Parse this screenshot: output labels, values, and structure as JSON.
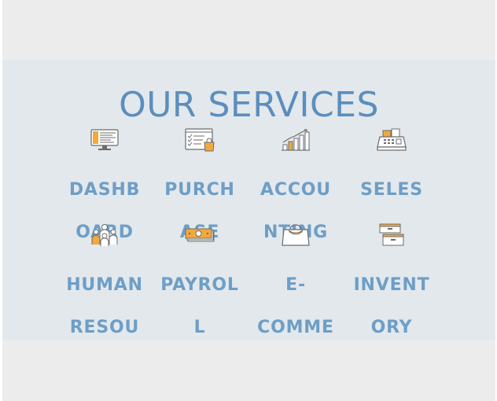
{
  "title": "OUR SERVICES",
  "colors": {
    "frame_bg": "#ececec",
    "band_bg": "#e3e8ec",
    "title": "#5b8ebf",
    "label": "#6d9ec7",
    "icon_stroke": "#6b6b6b",
    "icon_accent": "#f2a93b"
  },
  "services": [
    {
      "id": "dashboard",
      "icon": "monitor-dashboard-icon",
      "line1": "DASHB",
      "line2": "OARD"
    },
    {
      "id": "purchase",
      "icon": "purchase-bag-icon",
      "line1": "PURCH",
      "line2": "ASE"
    },
    {
      "id": "accounting",
      "icon": "growth-chart-icon",
      "line1": "ACCOU",
      "line2": "NTING"
    },
    {
      "id": "seles",
      "icon": "cash-register-icon",
      "line1": "SELES",
      "line2": ""
    },
    {
      "id": "human-resources",
      "icon": "people-group-icon",
      "line1": "HUMAN",
      "line2": "RESOU"
    },
    {
      "id": "payroll",
      "icon": "money-bills-icon",
      "line1": "PAYROL",
      "line2": "L"
    },
    {
      "id": "ecommerce",
      "icon": "shopping-bag-icon",
      "line1": "E-",
      "line2": "COMME"
    },
    {
      "id": "inventory",
      "icon": "archive-boxes-icon",
      "line1": "INVENT",
      "line2": "ORY"
    }
  ]
}
